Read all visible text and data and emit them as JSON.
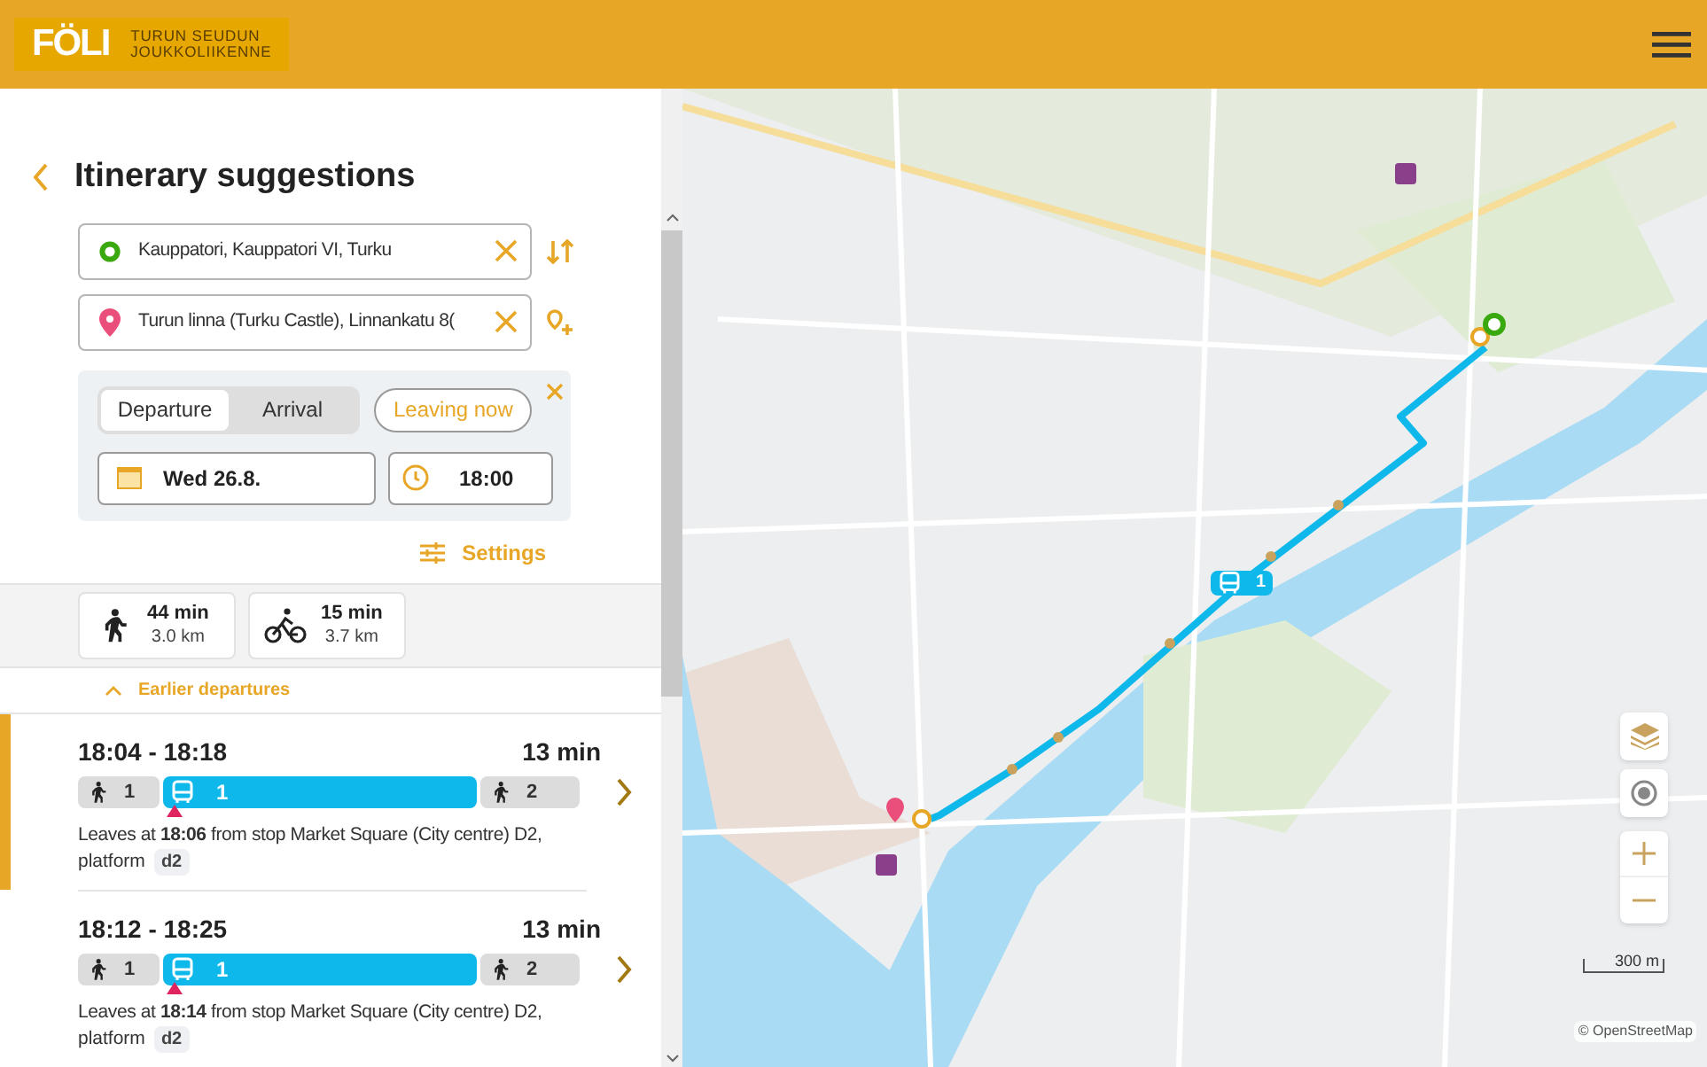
{
  "header": {
    "logo": {
      "name": "FÖLI",
      "subtitle": [
        "TURUN SEUDUN",
        "JOUKKOLIIKENNE"
      ]
    }
  },
  "title": "Itinerary suggestions",
  "origin": {
    "value": "Kauppatori, Kauppatori VI, Turku"
  },
  "destination": {
    "value": "Turun linna (Turku Castle), Linnankatu 8("
  },
  "time_panel": {
    "tabs": [
      {
        "label": "Departure",
        "selected": true
      },
      {
        "label": "Arrival",
        "selected": false
      }
    ],
    "leaving_now": "Leaving now",
    "date": "Wed 26.8.",
    "time": "18:00"
  },
  "settings": "Settings",
  "alternatives": [
    {
      "kind": "walk",
      "duration": "44 min",
      "distance": "3.0 km"
    },
    {
      "kind": "bike",
      "duration": "15 min",
      "distance": "3.7 km"
    }
  ],
  "earlier_departures": "Earlier departures",
  "itineraries": [
    {
      "time": "18:04 - 18:18",
      "duration": "13 min",
      "selected": true,
      "legs": [
        {
          "kind": "walk",
          "label": "1"
        },
        {
          "kind": "bus",
          "label": "1"
        },
        {
          "kind": "walk",
          "label": "2"
        }
      ],
      "description": "Leaves at **18:06** from stop Market Square (City centre) D2,",
      "platform_label": "platform",
      "platform": "d2"
    },
    {
      "time": "18:12 - 18:25",
      "duration": "13 min",
      "selected": false,
      "legs": [
        {
          "kind": "walk",
          "label": "1"
        },
        {
          "kind": "bus",
          "label": "1"
        },
        {
          "kind": "walk",
          "label": "2"
        }
      ],
      "description": "Leaves at **18:14** from stop Market Square (City centre) D2,",
      "platform_label": "platform",
      "platform": "d2"
    }
  ],
  "map": {
    "route_label": "1",
    "scale": "300 m",
    "attribution": "© OpenStreetMap"
  }
}
